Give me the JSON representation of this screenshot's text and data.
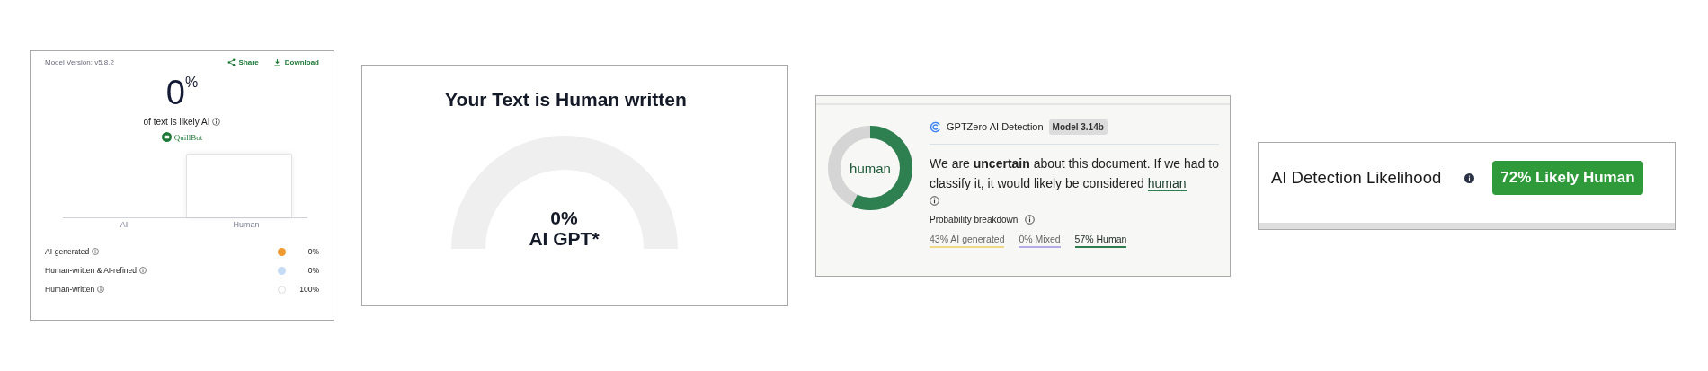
{
  "quillbot": {
    "model_version": "Model Version: v5.8.2",
    "actions": [
      {
        "kind": "share",
        "label": "Share"
      },
      {
        "kind": "download",
        "label": "Download"
      }
    ],
    "score": "0",
    "score_unit": "%",
    "caption": "of text is likely AI",
    "brand": "QuillBot",
    "bars": [
      {
        "label": "AI"
      },
      {
        "label": "Human"
      }
    ],
    "legend": [
      {
        "label": "AI-generated",
        "color": "#f39a2e",
        "value": "0%"
      },
      {
        "label": "Human-written & AI-refined",
        "color": "#c6dbf6",
        "value": "0%"
      },
      {
        "label": "Human-written",
        "color": "#ffffff",
        "value": "100%"
      }
    ]
  },
  "gpt_gauge": {
    "title": "Your Text is Human written",
    "value": "0%",
    "label": "AI GPT*"
  },
  "gptzero": {
    "verdict_label": "human",
    "product": "GPTZero AI Detection",
    "model": "Model 3.14b",
    "summary": "We are **uncertain** about this document. If we had to classify it, it would likely be considered",
    "summary_link": "human",
    "breakdown_title": "Probability breakdown",
    "breakdown": [
      {
        "label": "43% AI generated",
        "color": "#f1d98a",
        "selected": false
      },
      {
        "label": "0% Mixed",
        "color": "#b5abe6",
        "selected": false
      },
      {
        "label": "57% Human",
        "color": "#2e7d4f",
        "selected": true
      }
    ]
  },
  "likelihood": {
    "title": "AI Detection Likelihood",
    "badge": "72% Likely Human"
  }
}
